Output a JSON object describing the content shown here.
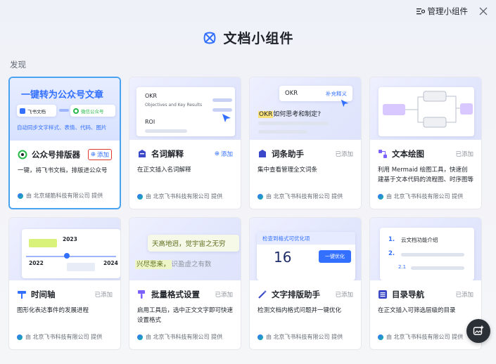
{
  "header": {
    "manage_label": "管理小组件",
    "title": "文档小组件",
    "section": "发现"
  },
  "preview_texts": {
    "wechat_headline": "一键转为公众号文章",
    "wechat_from": "飞书文档",
    "wechat_to": "微信公众号",
    "wechat_caption": "自动同步文字样式、表情、代码、图片",
    "okr_title": "OKR",
    "okr_sub": "Objectives and Key Results",
    "roi": "ROI",
    "okr_chip": "OKR",
    "okr_explain": "补充释义",
    "okr_question_tag": "OKR",
    "okr_question": "如何思考和制定?",
    "year_2022": "2022",
    "year_2023": "2023",
    "year_2024": "2024",
    "poem_line1": "天高地迥，觉宇宙之无穷",
    "poem_line2a": "兴尽悲来，",
    "poem_line2b": "识盈虚之有数",
    "check_label": "检查到格式可优化项",
    "check_count": "16",
    "optimize_button": "一键优化",
    "toc_1": "1.",
    "toc_1_title": "云文档功能介绍",
    "toc_2": "2.",
    "toc_21": "2.1"
  },
  "cards": [
    {
      "name": "公众号排版器",
      "status": "添加",
      "added": false,
      "desc": "一键，将飞书文档，排版进公众号",
      "provider": "由 北京燧筋科技有限公司 提供"
    },
    {
      "name": "名词解释",
      "status": "添加",
      "added": false,
      "desc": "在正文插入名词解释",
      "provider": "由 北京飞书科技有限公司 提供"
    },
    {
      "name": "词条助手",
      "status": "已添加",
      "added": true,
      "desc": "集中查看管理全文词条",
      "provider": "由 北京飞书科技有限公司 提供"
    },
    {
      "name": "文本绘图",
      "status": "已添加",
      "added": true,
      "desc": "利用 Mermaid 绘图工具，快速创建基于文本代码的流程图、时序图等图形",
      "provider": "由 北京飞书科技有限公司 提供"
    },
    {
      "name": "时间轴",
      "status": "已添加",
      "added": true,
      "desc": "图形化表达事件的发展进程",
      "provider": "由 北京飞书科技有限公司 提供"
    },
    {
      "name": "批量格式设置",
      "status": "已添加",
      "added": true,
      "desc": "启用工具后，选中正文文字即可快速设置格式",
      "provider": "由 北京飞书科技有限公司 提供"
    },
    {
      "name": "文字排版助手",
      "status": "已添加",
      "added": true,
      "desc": "检测文档内格式问题并一键优化",
      "provider": "由 北京飞书科技有限公司 提供"
    },
    {
      "name": "目录导航",
      "status": "已添加",
      "added": true,
      "desc": "在正文插入可筛选层级的目录",
      "provider": "由 北京飞书科技有限公司 提供"
    }
  ],
  "colors": {
    "accent": "#3370ff",
    "selected_border": "#4aa3f0",
    "highlight_box": "#e23b2e"
  }
}
